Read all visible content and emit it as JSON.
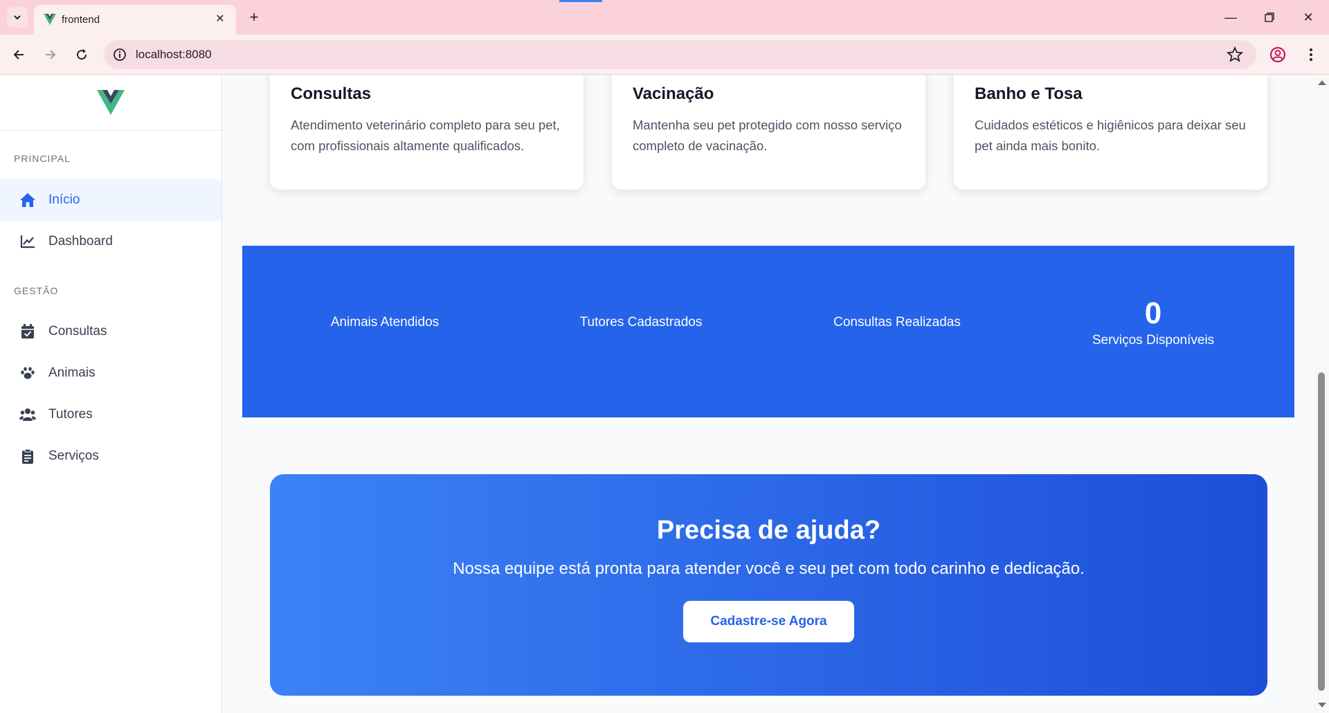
{
  "browser": {
    "tab_title": "frontend",
    "url": "localhost:8080"
  },
  "sidebar": {
    "sections": [
      {
        "title": "PRINCIPAL"
      },
      {
        "title": "GESTÃO"
      }
    ],
    "items": [
      {
        "label": "Início",
        "icon": "home-icon",
        "active": true
      },
      {
        "label": "Dashboard",
        "icon": "chart-line-icon"
      },
      {
        "label": "Consultas",
        "icon": "calendar-check-icon"
      },
      {
        "label": "Animais",
        "icon": "paw-icon"
      },
      {
        "label": "Tutores",
        "icon": "users-icon"
      },
      {
        "label": "Serviços",
        "icon": "clipboard-list-icon"
      }
    ]
  },
  "services": [
    {
      "title": "Consultas",
      "description": "Atendimento veterinário completo para seu pet, com profissionais altamente qualificados."
    },
    {
      "title": "Vacinação",
      "description": "Mantenha seu pet protegido com nosso serviço completo de vacinação."
    },
    {
      "title": "Banho e Tosa",
      "description": "Cuidados estéticos e higiênicos para deixar seu pet ainda mais bonito."
    }
  ],
  "stats": [
    {
      "value": "",
      "label": "Animais Atendidos"
    },
    {
      "value": "",
      "label": "Tutores Cadastrados"
    },
    {
      "value": "",
      "label": "Consultas Realizadas"
    },
    {
      "value": "0",
      "label": "Serviços Disponíveis"
    }
  ],
  "cta": {
    "title": "Precisa de ajuda?",
    "text": "Nossa equipe está pronta para atender você e seu pet com todo carinho e dedicação.",
    "button": "Cadastre-se Agora"
  },
  "colors": {
    "primary": "#2563eb",
    "vue_green": "#42b883",
    "vue_dark": "#35495e"
  }
}
